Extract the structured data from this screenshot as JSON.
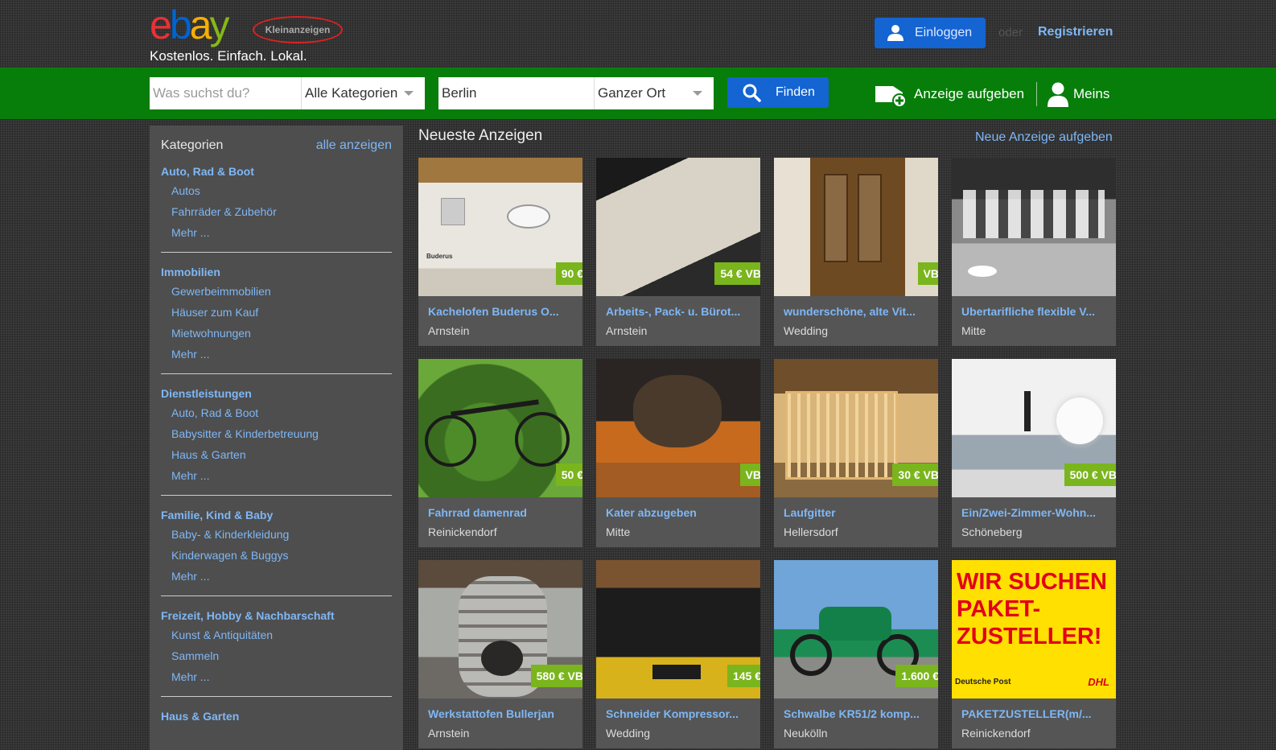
{
  "header": {
    "logo_text": "ebay",
    "logo_badge": "Kleinanzeigen",
    "tagline": "Kostenlos. Einfach. Lokal.",
    "login_label": "Einloggen",
    "or_label": "oder",
    "register_label": "Registrieren"
  },
  "search": {
    "query_placeholder": "Was suchst du?",
    "category_value": "Alle Kategorien",
    "location_value": "Berlin",
    "radius_value": "Ganzer Ort",
    "find_label": "Finden",
    "post_ad_label": "Anzeige aufgeben",
    "meins_label": "Meins"
  },
  "sidebar": {
    "title": "Kategorien",
    "all_label": "alle anzeigen",
    "groups": [
      {
        "title": "Auto, Rad & Boot",
        "items": [
          "Autos",
          "Fahrräder & Zubehör",
          "Mehr ..."
        ]
      },
      {
        "title": "Immobilien",
        "items": [
          "Gewerbeimmobilien",
          "Häuser zum Kauf",
          "Mietwohnungen",
          "Mehr ..."
        ]
      },
      {
        "title": "Dienstleistungen",
        "items": [
          "Auto, Rad & Boot",
          "Babysitter & Kinderbetreuung",
          "Haus & Garten",
          "Mehr ..."
        ]
      },
      {
        "title": "Familie, Kind & Baby",
        "items": [
          "Baby- & Kinderkleidung",
          "Kinderwagen & Buggys",
          "Mehr ..."
        ]
      },
      {
        "title": "Freizeit, Hobby & Nachbarschaft",
        "items": [
          "Kunst & Antiquitäten",
          "Sammeln",
          "Mehr ..."
        ]
      },
      {
        "title": "Haus & Garten",
        "items": []
      }
    ]
  },
  "main": {
    "title": "Neueste Anzeigen",
    "new_ad_link": "Neue Anzeige aufgeben",
    "listings": [
      {
        "title": "Kachelofen Buderus O...",
        "location": "Arnstein",
        "price": "90 €",
        "thumb_text": "Buderus"
      },
      {
        "title": "Arbeits-, Pack- u. Bürot...",
        "location": "Arnstein",
        "price": "54 € VB"
      },
      {
        "title": "wunderschöne, alte Vit...",
        "location": "Wedding",
        "price": "VB"
      },
      {
        "title": "Ubertarifliche flexible V...",
        "location": "Mitte",
        "price": ""
      },
      {
        "title": "Fahrrad damenrad",
        "location": "Reinickendorf",
        "price": "50 €"
      },
      {
        "title": "Kater abzugeben",
        "location": "Mitte",
        "price": "VB"
      },
      {
        "title": "Laufgitter",
        "location": "Hellersdorf",
        "price": "30 € VB"
      },
      {
        "title": "Ein/Zwei-Zimmer-Wohn...",
        "location": "Schöneberg",
        "price": "500 € VB"
      },
      {
        "title": "Werkstattofen Bullerjan",
        "location": "Arnstein",
        "price": "580 € VB"
      },
      {
        "title": "Schneider Kompressor...",
        "location": "Wedding",
        "price": "145 €"
      },
      {
        "title": "Schwalbe KR51/2 komp...",
        "location": "Neukölln",
        "price": "1.600 €"
      },
      {
        "title": "PAKETZUSTELLER(m/...",
        "location": "Reinickendorf",
        "price": "",
        "ad_headline": "WIR SUCHEN PAKET-ZUSTELLER!",
        "ad_footer_left": "Deutsche Post",
        "ad_footer_right": "DHL"
      }
    ]
  },
  "colors": {
    "search_bar": "#077e0a",
    "primary_button": "#1464d2",
    "link": "#7fb7f5",
    "price_badge": "#7ab51d",
    "sidebar_bg": "#4e4e4e"
  }
}
